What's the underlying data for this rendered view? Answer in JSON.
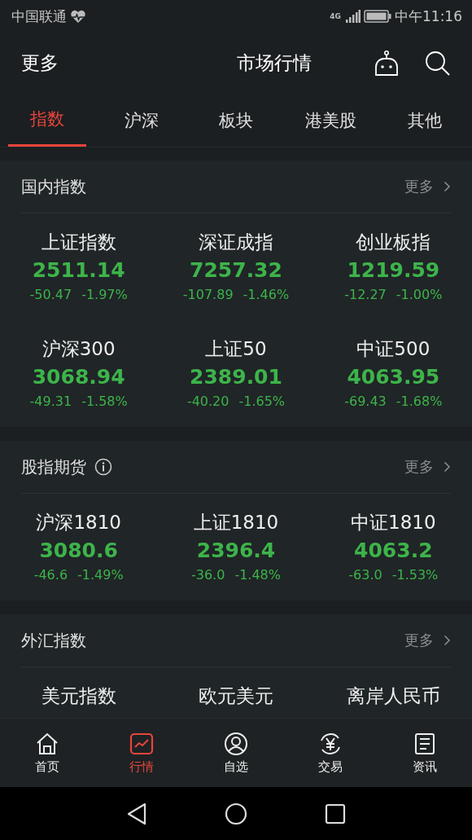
{
  "status_bar": {
    "carrier": "中国联通",
    "network": "4G",
    "time": "中午11:16"
  },
  "header": {
    "left": "更多",
    "title": "市场行情"
  },
  "tabs": [
    {
      "label": "指数",
      "selected": true
    },
    {
      "label": "沪深",
      "selected": false
    },
    {
      "label": "板块",
      "selected": false
    },
    {
      "label": "港美股",
      "selected": false
    },
    {
      "label": "其他",
      "selected": false
    }
  ],
  "sections": [
    {
      "title": "国内指数",
      "info": false,
      "more": "更多",
      "items": [
        {
          "name": "上证指数",
          "value": "2511.14",
          "change": "-50.47",
          "percent": "-1.97%",
          "kind": "down"
        },
        {
          "name": "深证成指",
          "value": "7257.32",
          "change": "-107.89",
          "percent": "-1.46%",
          "kind": "down"
        },
        {
          "name": "创业板指",
          "value": "1219.59",
          "change": "-12.27",
          "percent": "-1.00%",
          "kind": "down"
        },
        {
          "name": "沪深300",
          "value": "3068.94",
          "change": "-49.31",
          "percent": "-1.58%",
          "kind": "down"
        },
        {
          "name": "上证50",
          "value": "2389.01",
          "change": "-40.20",
          "percent": "-1.65%",
          "kind": "down"
        },
        {
          "name": "中证500",
          "value": "4063.95",
          "change": "-69.43",
          "percent": "-1.68%",
          "kind": "down"
        }
      ]
    },
    {
      "title": "股指期货",
      "info": true,
      "more": "更多",
      "items": [
        {
          "name": "沪深1810",
          "value": "3080.6",
          "change": "-46.6",
          "percent": "-1.49%",
          "kind": "down"
        },
        {
          "name": "上证1810",
          "value": "2396.4",
          "change": "-36.0",
          "percent": "-1.48%",
          "kind": "down"
        },
        {
          "name": "中证1810",
          "value": "4063.2",
          "change": "-63.0",
          "percent": "-1.53%",
          "kind": "down"
        }
      ]
    },
    {
      "title": "外汇指数",
      "info": false,
      "more": "更多",
      "items": [
        {
          "name": "美元指数"
        },
        {
          "name": "欧元美元"
        },
        {
          "name": "离岸人民币"
        }
      ]
    }
  ],
  "bottom_nav": [
    {
      "label": "首页",
      "kind": "home",
      "selected": false
    },
    {
      "label": "行情",
      "kind": "chart",
      "selected": true
    },
    {
      "label": "自选",
      "kind": "person",
      "selected": false
    },
    {
      "label": "交易",
      "kind": "yen",
      "selected": false
    },
    {
      "label": "资讯",
      "kind": "news",
      "selected": false
    }
  ]
}
